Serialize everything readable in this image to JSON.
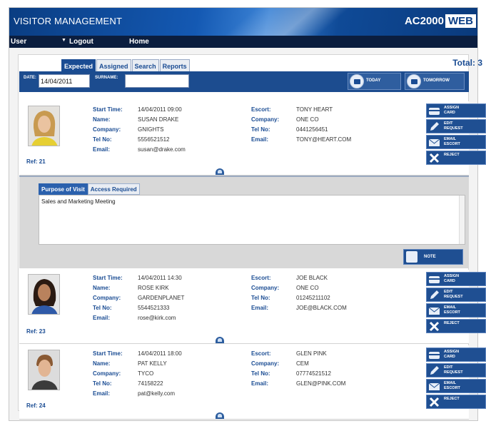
{
  "header": {
    "title": "VISITOR MANAGEMENT",
    "brand": "AC2000",
    "brand_suffix": "WEB"
  },
  "menu": {
    "user": "User",
    "logout": "Logout",
    "home": "Home"
  },
  "tabs": [
    "Expected",
    "Assigned",
    "Search",
    "Reports"
  ],
  "active_tab": "Expected",
  "total": "Total: 3",
  "filter": {
    "date_label": "DATE:",
    "date_value": "14/04/2011",
    "surname_label": "SURNAME:",
    "surname_value": "",
    "today": "TODAY",
    "tomorrow": "TOMORROW"
  },
  "labels": {
    "start_time": "Start Time:",
    "name": "Name:",
    "company": "Company:",
    "tel": "Tel No:",
    "email": "Email:",
    "escort": "Escort:",
    "escort_company": "Company:",
    "escort_tel": "Tel No:",
    "escort_email": "Email:"
  },
  "actions": [
    "ASSIGN\nCARD",
    "EDIT\nREQUEST",
    "EMAIL\nESCORT",
    "REJECT"
  ],
  "visitors": [
    {
      "ref": "Ref: 21",
      "start_time": "14/04/2011 09:00",
      "name": "SUSAN DRAKE",
      "company": "GNIGHTS",
      "tel": "5556521512",
      "email": "susan@drake.com",
      "escort": "TONY HEART",
      "escort_company": "ONE CO",
      "escort_tel": "0441256451",
      "escort_email": "TONY@HEART.COM"
    },
    {
      "ref": "Ref: 23",
      "start_time": "14/04/2011 14:30",
      "name": "ROSE KIRK",
      "company": "GARDENPLANET",
      "tel": "5544521333",
      "email": "rose@kirk.com",
      "escort": "JOE BLACK",
      "escort_company": "ONE CO",
      "escort_tel": "01245211102",
      "escort_email": "JOE@BLACK.COM"
    },
    {
      "ref": "Ref: 24",
      "start_time": "14/04/2011 18:00",
      "name": "PAT KELLY",
      "company": "TYCO",
      "tel": "74158222",
      "email": "pat@kelly.com",
      "escort": "GLEN PINK",
      "escort_company": "CEM",
      "escort_tel": "07774521512",
      "escort_email": "GLEN@PINK.COM"
    }
  ],
  "detail": {
    "tabs": [
      "Purpose of Visit",
      "Access Required"
    ],
    "active_tab": "Purpose of Visit",
    "text": "Sales and Marketing Meeting",
    "note_button": "NOTE"
  },
  "colors": {
    "primary": "#1a4c93",
    "menubar": "#0b1e3f"
  }
}
